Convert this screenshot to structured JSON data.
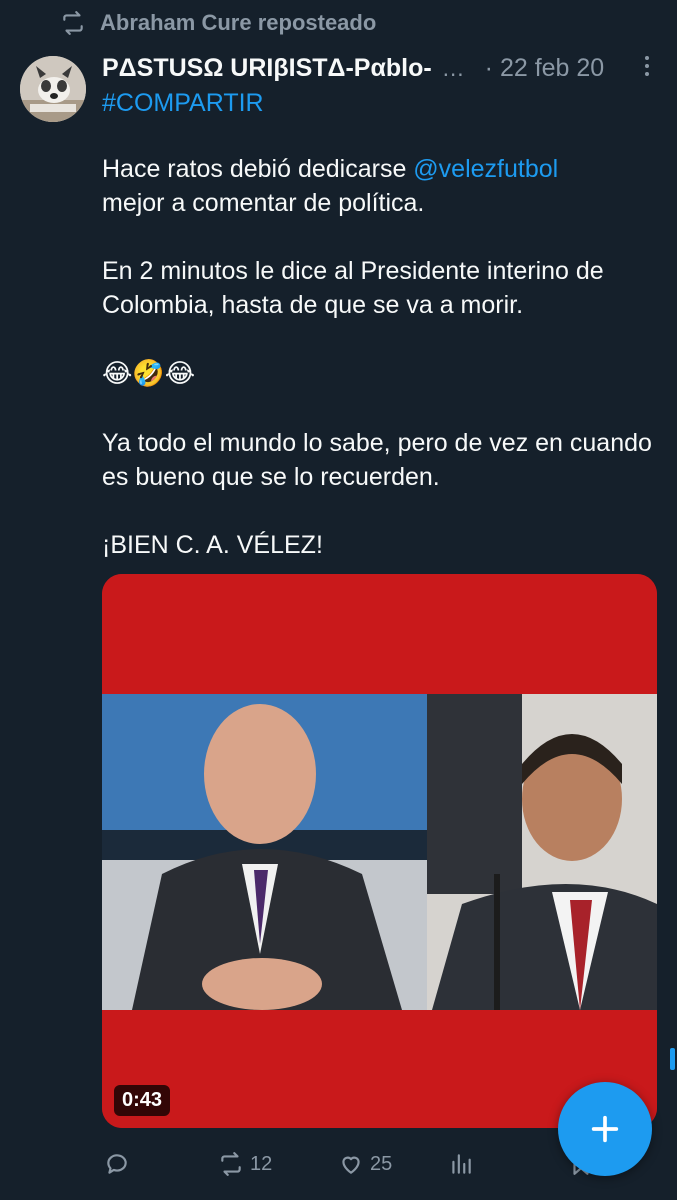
{
  "repost": {
    "text": "Abraham Cure reposteado",
    "icon": "repost-icon"
  },
  "tweet": {
    "author_name": "PΔSTUSΩ URIβISTΔ-Pαblo-",
    "name_ellipsis": "…",
    "date": "· 22 feb 20",
    "hashtag": "#COMPARTIR",
    "line1_pre": "Hace ratos debió dedicarse ",
    "mention": "@velezfutbol",
    "line1_post": "mejor a comentar de política.",
    "para2": "En 2 minutos le dice al Presidente interino de Colombia, hasta de que se va a morir.",
    "emojis": "😂🤣😂",
    "para3": "Ya todo el mundo lo sabe, pero de vez en cuando es bueno que se lo recuerden.",
    "para4": "¡BIEN C. A. VÉLEZ!"
  },
  "media": {
    "duration": "0:43",
    "frame_color": "#c9191b"
  },
  "actions": {
    "reposts": "12",
    "likes": "25"
  },
  "colors": {
    "background": "#15202b",
    "accent": "#1d9bf0",
    "muted": "#8b98a5"
  },
  "fab": {
    "icon": "plus-icon"
  }
}
